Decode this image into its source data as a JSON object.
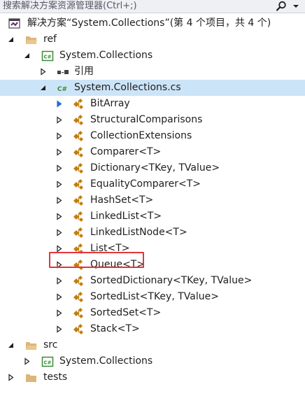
{
  "search": {
    "placeholder": "搜索解决方案资源管理器(Ctrl+;)"
  },
  "tree": {
    "solution_label": "解决方案“System.Collections”(第 4 个项目，共 4 个)",
    "ref_folder": "ref",
    "ref_project": "System.Collections",
    "references": "引用",
    "cs_file": "System.Collections.cs",
    "classes": [
      "BitArray",
      "StructuralComparisons",
      "CollectionExtensions",
      "Comparer<T>",
      "Dictionary<TKey, TValue>",
      "EqualityComparer<T>",
      "HashSet<T>",
      "LinkedList<T>",
      "LinkedListNode<T>",
      "List<T>",
      "Queue<T>",
      "SortedDictionary<TKey, TValue>",
      "SortedList<TKey, TValue>",
      "SortedSet<T>",
      "Stack<T>"
    ],
    "src_folder": "src",
    "src_project": "System.Collections",
    "tests_folder": "tests"
  },
  "colors": {
    "selection": "#cce4f7",
    "highlight_box": "#e5343a",
    "folder": "#dcb67a",
    "class_icon": "#c27d0e",
    "csharp_project": "#388a34"
  }
}
